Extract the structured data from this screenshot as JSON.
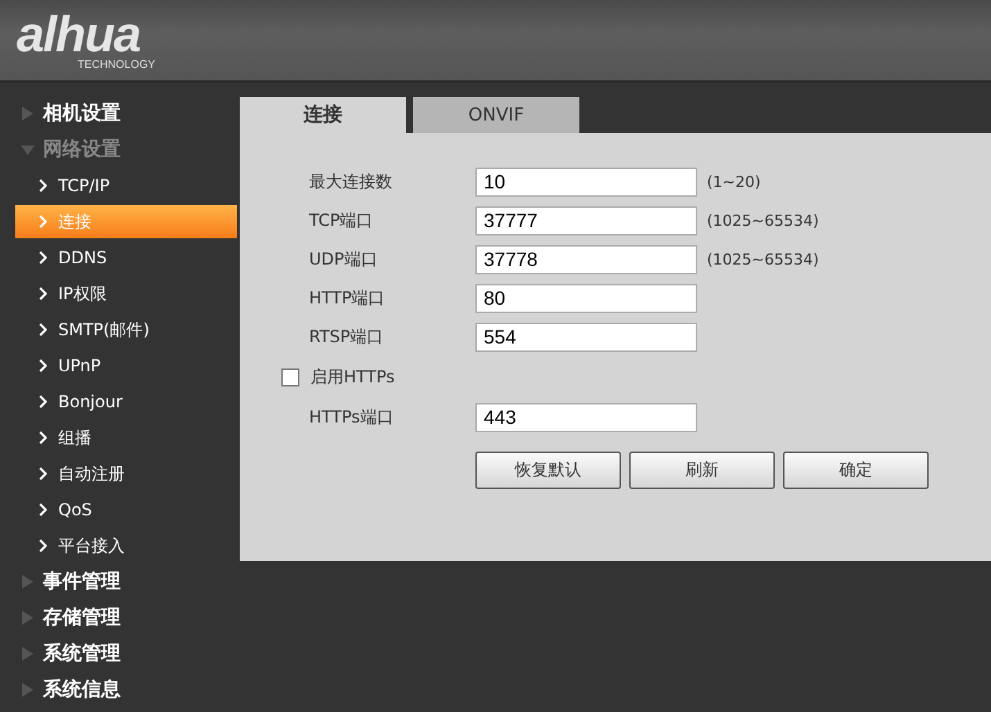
{
  "header": {
    "logo": "alhua",
    "logo_subtitle": "TECHNOLOGY"
  },
  "sidebar": {
    "items": [
      {
        "label": "相机设置",
        "expanded": false
      },
      {
        "label": "网络设置",
        "expanded": true,
        "children": [
          {
            "label": "TCP/IP",
            "selected": false
          },
          {
            "label": "连接",
            "selected": true
          },
          {
            "label": "DDNS",
            "selected": false
          },
          {
            "label": "IP权限",
            "selected": false
          },
          {
            "label": "SMTP(邮件)",
            "selected": false
          },
          {
            "label": "UPnP",
            "selected": false
          },
          {
            "label": "Bonjour",
            "selected": false
          },
          {
            "label": "组播",
            "selected": false
          },
          {
            "label": "自动注册",
            "selected": false
          },
          {
            "label": "QoS",
            "selected": false
          },
          {
            "label": "平台接入",
            "selected": false
          }
        ]
      },
      {
        "label": "事件管理",
        "expanded": false
      },
      {
        "label": "存储管理",
        "expanded": false
      },
      {
        "label": "系统管理",
        "expanded": false
      },
      {
        "label": "系统信息",
        "expanded": false
      }
    ]
  },
  "tabs": [
    {
      "label": "连接",
      "selected": true
    },
    {
      "label": "ONVIF",
      "selected": false
    }
  ],
  "form": [
    {
      "kind": "field",
      "label": "最大连接数",
      "value": "10",
      "hint": "(1~20)"
    },
    {
      "kind": "field",
      "label": "TCP端口",
      "value": "37777",
      "hint": "(1025~65534)"
    },
    {
      "kind": "field",
      "label": "UDP端口",
      "value": "37778",
      "hint": "(1025~65534)"
    },
    {
      "kind": "field",
      "label": "HTTP端口",
      "value": "80"
    },
    {
      "kind": "field",
      "label": "RTSP端口",
      "value": "554"
    },
    {
      "kind": "checkbox",
      "label": "启用HTTPs",
      "checked": false
    },
    {
      "kind": "field",
      "label": "HTTPs端口",
      "value": "443"
    }
  ],
  "buttons": [
    "恢复默认",
    "刷新",
    "确定"
  ]
}
